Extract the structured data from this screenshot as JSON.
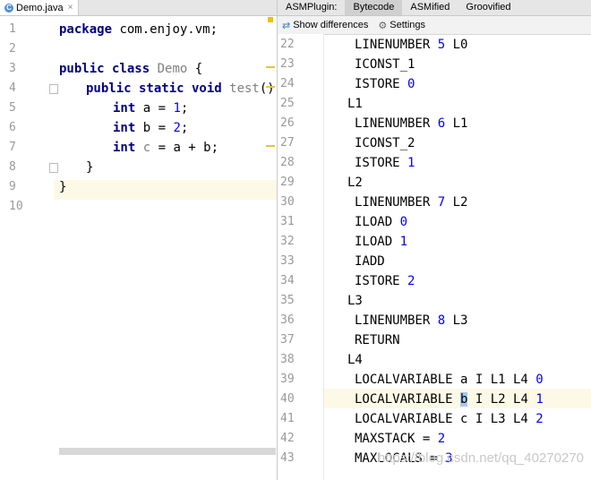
{
  "editor": {
    "tab_label": "Demo.java",
    "tab_icon": "c-class-icon",
    "lines": [
      {
        "n": "1"
      },
      {
        "n": "2"
      },
      {
        "n": "3"
      },
      {
        "n": "4"
      },
      {
        "n": "5"
      },
      {
        "n": "6"
      },
      {
        "n": "7"
      },
      {
        "n": "8"
      },
      {
        "n": "9"
      },
      {
        "n": "10"
      }
    ],
    "code": {
      "l1_kw": "package",
      "l1_rest": " com.enjoy.vm;",
      "l3_kw": "public class",
      "l3_name": " Demo",
      "l3_brace": " {",
      "l4_kw": "public static void",
      "l4_name": " test",
      "l4_rest": "() {",
      "l5_kw": "int",
      "l5_a": " a = ",
      "l5_num": "1",
      "l5_end": ";",
      "l6_kw": "int",
      "l6_a": " b = ",
      "l6_num": "2",
      "l6_end": ";",
      "l7_kw": "int",
      "l7_c": " c",
      "l7_rest": " = a + b;",
      "l8": "}",
      "l9": "}"
    }
  },
  "asm": {
    "plugin_label": "ASMPlugin:",
    "tabs": [
      "Bytecode",
      "ASMified",
      "Groovified"
    ],
    "active_tab": "Bytecode",
    "toolbar": {
      "show_diff": "Show differences",
      "settings": "Settings"
    },
    "lines": [
      {
        "n": "22",
        "t": "LINENUMBER ",
        "num": "5",
        "rest": " L0"
      },
      {
        "n": "23",
        "t": "ICONST_1"
      },
      {
        "n": "24",
        "t": "ISTORE ",
        "num": "0"
      },
      {
        "n": "25",
        "t": "L1",
        "label": true
      },
      {
        "n": "26",
        "t": "LINENUMBER ",
        "num": "6",
        "rest": " L1"
      },
      {
        "n": "27",
        "t": "ICONST_2"
      },
      {
        "n": "28",
        "t": "ISTORE ",
        "num": "1"
      },
      {
        "n": "29",
        "t": "L2",
        "label": true
      },
      {
        "n": "30",
        "t": "LINENUMBER ",
        "num": "7",
        "rest": " L2"
      },
      {
        "n": "31",
        "t": "ILOAD ",
        "num": "0"
      },
      {
        "n": "32",
        "t": "ILOAD ",
        "num": "1"
      },
      {
        "n": "33",
        "t": "IADD"
      },
      {
        "n": "34",
        "t": "ISTORE ",
        "num": "2"
      },
      {
        "n": "35",
        "t": "L3",
        "label": true
      },
      {
        "n": "36",
        "t": "LINENUMBER ",
        "num": "8",
        "rest": " L3"
      },
      {
        "n": "37",
        "t": "RETURN"
      },
      {
        "n": "38",
        "t": "L4",
        "label": true
      },
      {
        "n": "39",
        "t": "LOCALVARIABLE a I L1 L4 ",
        "num": "0"
      },
      {
        "n": "40",
        "t": "LOCALVARIABLE ",
        "sel": "b",
        "rest": " I L2 L4 ",
        "num2": "1"
      },
      {
        "n": "41",
        "t": "LOCALVARIABLE c I L3 L4 ",
        "num": "2"
      },
      {
        "n": "42",
        "t": "MAXSTACK = ",
        "num": "2"
      },
      {
        "n": "43",
        "t": "MAXLOCALS = ",
        "num": "3"
      }
    ],
    "watermark": "https://blog.csdn.net/qq_40270270"
  }
}
